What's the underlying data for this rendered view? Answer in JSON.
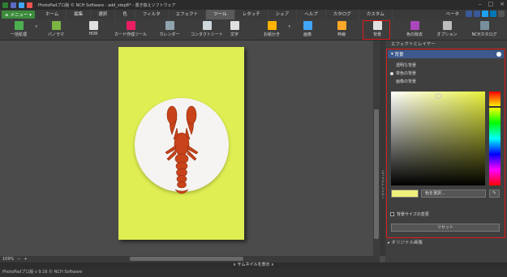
{
  "window": {
    "title": "PhotoPadプロ版 © NCH Software - add_step8* - 書き換えソフトウェア",
    "controls": [
      "–",
      "□",
      "×"
    ]
  },
  "menubar": {
    "menu_button": "≡ メニュー ▾",
    "tabs": [
      "ホーム",
      "編集",
      "選択",
      "色",
      "フィルタ",
      "エフェクト",
      "ツール",
      "レタッチ",
      "シェア",
      "ヘルプ",
      "カタログ",
      "カスタム"
    ],
    "active_tab": "ツール",
    "beta_label": "ベータ"
  },
  "toolbar": {
    "tools": [
      {
        "label": "一括処理",
        "icon": "batch-icon",
        "color": "#4caf50",
        "dropdown": true
      },
      {
        "label": "パノラマ",
        "icon": "panorama-icon",
        "color": "#7cb342",
        "dropdown": false
      },
      {
        "label": "HDR",
        "icon": "hdr-icon",
        "color": "#e0e0e0",
        "dropdown": false
      },
      {
        "label": "カード作成ツール",
        "icon": "card-icon",
        "color": "#e91e63",
        "dropdown": false
      },
      {
        "label": "カレンダー",
        "icon": "calendar-icon",
        "color": "#90a4ae",
        "dropdown": false
      },
      {
        "label": "コンタクトシート",
        "icon": "contact-sheet-icon",
        "color": "#cfd8dc",
        "dropdown": false
      },
      {
        "label": "文字",
        "icon": "text-icon",
        "color": "#e0e0e0",
        "dropdown": false
      },
      {
        "label": "お絵かき",
        "icon": "brush-icon",
        "color": "#ffb300",
        "dropdown": true
      },
      {
        "label": "画像",
        "icon": "image-icon",
        "color": "#42a5f5",
        "dropdown": false
      },
      {
        "label": "枠線",
        "icon": "border-icon",
        "color": "#ffa726",
        "dropdown": false
      },
      {
        "label": "背景",
        "icon": "background-icon",
        "color": "#e0e0e0",
        "dropdown": false
      },
      {
        "label": "色の除去",
        "icon": "color-remove-icon",
        "color": "#ab47bc",
        "dropdown": false
      },
      {
        "label": "オプション",
        "icon": "options-icon",
        "color": "#bdbdbd",
        "dropdown": false
      },
      {
        "label": "NCHカタログ",
        "icon": "catalog-icon",
        "color": "#78909c",
        "dropdown": false
      }
    ]
  },
  "side_tab": {
    "label": "エフェクトレイヤー"
  },
  "panel": {
    "header": "エフェクトとレイヤー",
    "section_title": "背景",
    "options": [
      {
        "label": "透明な背景",
        "selected": false
      },
      {
        "label": "単色の背景",
        "selected": true
      },
      {
        "label": "画像の背景",
        "selected": false
      }
    ],
    "selected_color": "#eef07a",
    "choose_color_label": "色を選択...",
    "resize_checkbox_label": "背景サイズの変更",
    "resize_checked": false,
    "reset_label": "リセット",
    "original_label": "オリジナル画像"
  },
  "status": {
    "zoom": "109%",
    "thumbnail_label": "∧ サムネイルを表示 ∧",
    "version": "PhotoPadプロ版 v 9.16 © NCH Software"
  }
}
